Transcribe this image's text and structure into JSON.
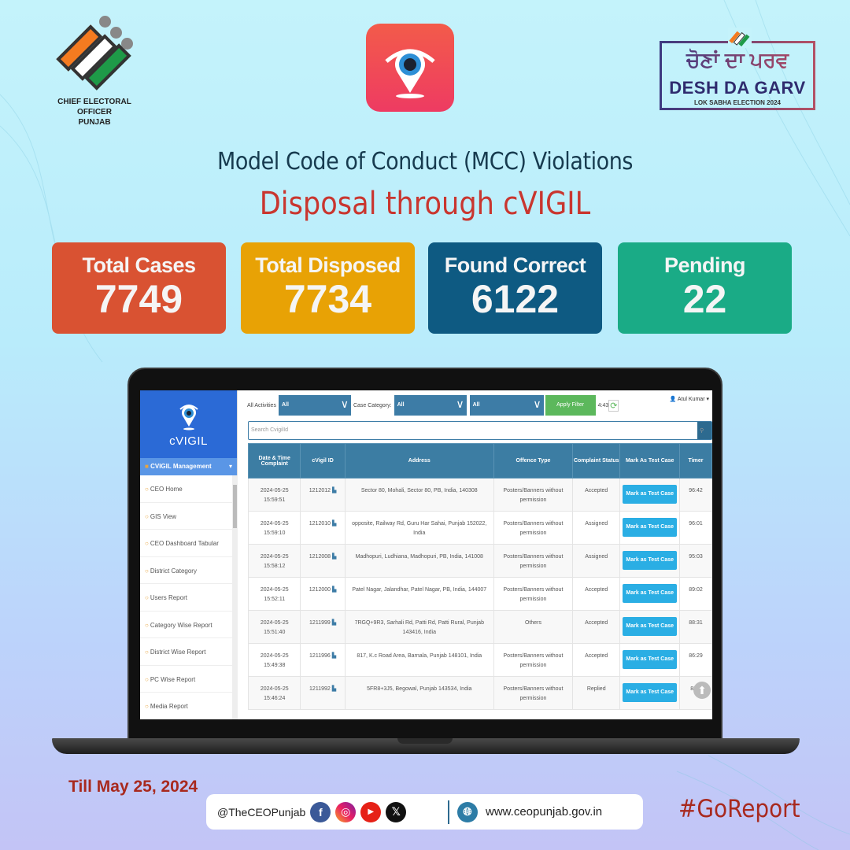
{
  "header": {
    "eci_logo_text_line1": "CHIEF ELECTORAL OFFICER",
    "eci_logo_text_line2": "PUNJAB",
    "campaign_punjabi": "ਚੋਣਾਂ ਦਾ ਪਰਵ",
    "campaign_english": "DESH DA GARV",
    "campaign_sub": "LOK SABHA ELECTION 2024"
  },
  "title": {
    "line1": "Model Code of Conduct (MCC) Violations",
    "line2": "Disposal through cVIGIL"
  },
  "stats": [
    {
      "label": "Total Cases",
      "value": "7749",
      "color": "#d95232"
    },
    {
      "label": "Total Disposed",
      "value": "7734",
      "color": "#e8a205"
    },
    {
      "label": "Found Correct",
      "value": "6122",
      "color": "#0e5a82"
    },
    {
      "label": "Pending",
      "value": "22",
      "color": "#1aab86"
    }
  ],
  "app": {
    "logo_text": "cVIGIL",
    "sidebar": {
      "section": "CVIGIL Management",
      "items": [
        "CEO Home",
        "GIS View",
        "CEO Dashboard Tabular",
        "District Category",
        "Users Report",
        "Category Wise Report",
        "District Wise Report",
        "PC Wise Report",
        "Media Report"
      ]
    },
    "filters": {
      "all_activities_label": "All Activities",
      "all_activities_value": "All",
      "case_category_label": "Case Category:",
      "case_category_value": "All",
      "third_value": "All",
      "apply_label": "Apply Filter",
      "time": "4:43"
    },
    "user": "Atul Kumar",
    "search_placeholder": "Search CvigilId",
    "table": {
      "headers": [
        "Date & Time Complaint",
        "cVigil ID",
        "Address",
        "Offence Type",
        "Complaint Status",
        "Mark As Test Case",
        "Timer"
      ],
      "button_label": "Mark as Test Case",
      "rows": [
        {
          "date": "2024-05-25",
          "time": "15:59:51",
          "id": "1212012",
          "address": "Sector 80, Mohali, Sector 80, PB, India, 140308",
          "offence": "Posters/Banners without permission",
          "status": "Accepted",
          "timer": "96:42"
        },
        {
          "date": "2024-05-25",
          "time": "15:59:10",
          "id": "1212010",
          "address": "opposite, Railway Rd, Guru Har Sahai, Punjab 152022, India",
          "offence": "Posters/Banners without permission",
          "status": "Assigned",
          "timer": "96:01"
        },
        {
          "date": "2024-05-25",
          "time": "15:58:12",
          "id": "1212008",
          "address": "Madhopuri, Ludhiana, Madhopuri, PB, India, 141008",
          "offence": "Posters/Banners without permission",
          "status": "Assigned",
          "timer": "95:03"
        },
        {
          "date": "2024-05-25",
          "time": "15:52:11",
          "id": "1212000",
          "address": "Patel Nagar, Jalandhar, Patel Nagar, PB, India, 144007",
          "offence": "Posters/Banners without permission",
          "status": "Accepted",
          "timer": "89:02"
        },
        {
          "date": "2024-05-25",
          "time": "15:51:40",
          "id": "1211999",
          "address": "7RGQ+9R3, Sarhali Rd, Patti Rd, Patti Rural, Punjab 143416, India",
          "offence": "Others",
          "status": "Accepted",
          "timer": "88:31"
        },
        {
          "date": "2024-05-25",
          "time": "15:49:38",
          "id": "1211996",
          "address": "817, K.c Road Area, Barnala, Punjab 148101, India",
          "offence": "Posters/Banners without permission",
          "status": "Accepted",
          "timer": "86:29"
        },
        {
          "date": "2024-05-25",
          "time": "15:46:24",
          "id": "1211992",
          "address": "5FR8+3J5, Begowal, Punjab 143534, India",
          "offence": "Posters/Banners without permission",
          "status": "Replied",
          "timer": "83:1"
        }
      ]
    }
  },
  "footer": {
    "date": "Till May 25, 2024",
    "handle": "@TheCEOPunjab",
    "website": "www.ceopunjab.gov.in",
    "hashtag": "#GoReport"
  }
}
